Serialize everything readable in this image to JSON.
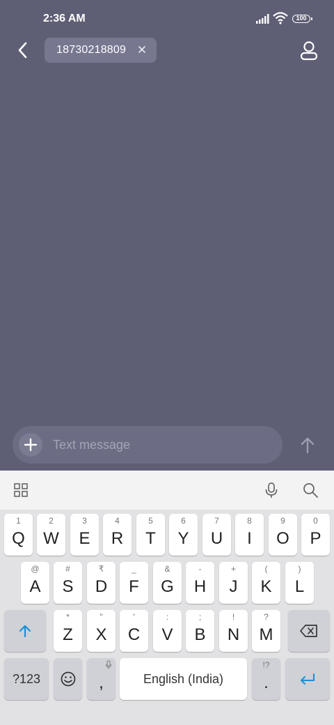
{
  "status": {
    "time": "2:36 AM",
    "battery": "100"
  },
  "header": {
    "recipient": "18730218809",
    "chip_close": "×"
  },
  "compose": {
    "placeholder": "Text message"
  },
  "keyboard": {
    "row1": [
      {
        "main": "Q",
        "hint": "1"
      },
      {
        "main": "W",
        "hint": "2"
      },
      {
        "main": "E",
        "hint": "3"
      },
      {
        "main": "R",
        "hint": "4"
      },
      {
        "main": "T",
        "hint": "5"
      },
      {
        "main": "Y",
        "hint": "6"
      },
      {
        "main": "U",
        "hint": "7"
      },
      {
        "main": "I",
        "hint": "8"
      },
      {
        "main": "O",
        "hint": "9"
      },
      {
        "main": "P",
        "hint": "0"
      }
    ],
    "row2": [
      {
        "main": "A",
        "hint": "@"
      },
      {
        "main": "S",
        "hint": "#"
      },
      {
        "main": "D",
        "hint": "₹"
      },
      {
        "main": "F",
        "hint": "_"
      },
      {
        "main": "G",
        "hint": "&"
      },
      {
        "main": "H",
        "hint": "-"
      },
      {
        "main": "J",
        "hint": "+"
      },
      {
        "main": "K",
        "hint": "("
      },
      {
        "main": "L",
        "hint": ")"
      }
    ],
    "row3": [
      {
        "main": "Z",
        "hint": "*"
      },
      {
        "main": "X",
        "hint": "\""
      },
      {
        "main": "C",
        "hint": "'"
      },
      {
        "main": "V",
        "hint": ":"
      },
      {
        "main": "B",
        "hint": ";"
      },
      {
        "main": "N",
        "hint": "!"
      },
      {
        "main": "M",
        "hint": "?"
      }
    ],
    "symbols_label": "?123",
    "comma": ",",
    "space_label": "English (India)",
    "period": ".",
    "period_hint": "!?",
    "accent_color": "#1a8fd8"
  }
}
